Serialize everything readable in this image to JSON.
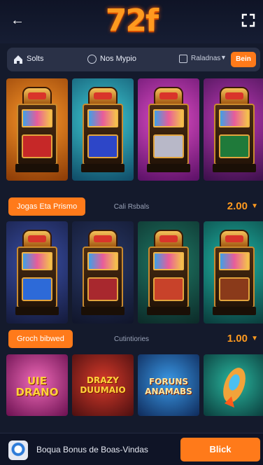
{
  "header": {
    "logo_text": "72f",
    "back_icon": "arrow-left-icon",
    "menu_icon": "grid-menu-icon"
  },
  "searchbar": {
    "home_label": "Solts",
    "middle_label": "Nos Mypio",
    "dropdown_label": "Raladnas",
    "button_label": "Bein"
  },
  "sections": [
    {
      "pill_label": "Jogas Eta Prismo",
      "mid_label": "Cali Rsbals",
      "value": "2.00"
    },
    {
      "pill_label": "Groch bibwed",
      "mid_label": "Cutintiories",
      "value": "1.00"
    }
  ],
  "art_tiles": [
    {
      "text": "UIE\nDRANO"
    },
    {
      "text": "DRAZY\nDUUMAIO"
    },
    {
      "text": "FORUNS\nANAMABS"
    },
    {
      "text": ""
    }
  ],
  "bottom": {
    "bonus_text": "Boqua Bonus de Boas-Vindas",
    "cta_label": "Blick"
  },
  "colors": {
    "accent": "#ff7a1a",
    "background": "#141a2c",
    "value_color": "#ff9a1f"
  }
}
